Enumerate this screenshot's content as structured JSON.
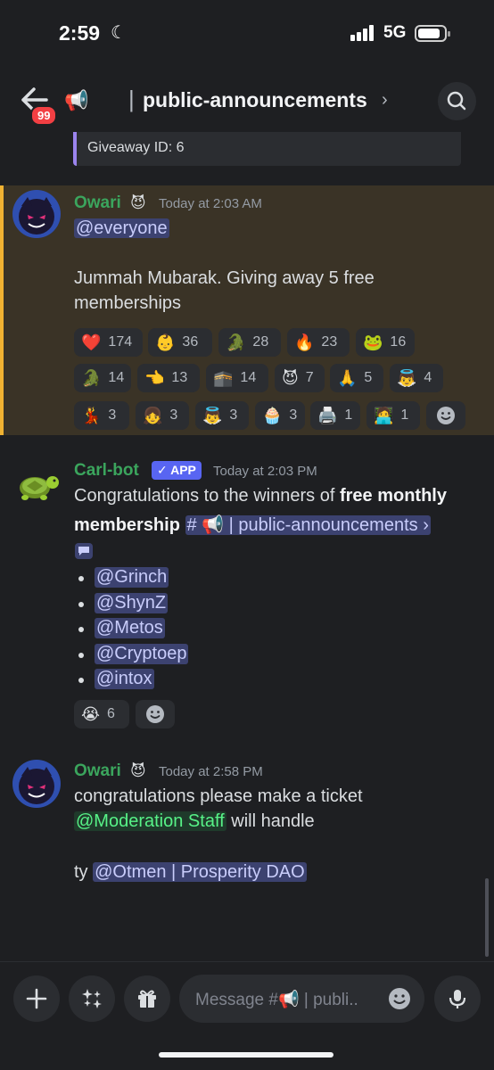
{
  "status": {
    "time": "2:59",
    "network": "5G"
  },
  "header": {
    "badge": "99",
    "channel_name": "public-announcements",
    "separator": "|",
    "chevron": "›"
  },
  "prev_embed": {
    "footer": "Giveaway ID: 6"
  },
  "messages": [
    {
      "author": "Owari",
      "timestamp": "Today at 2:03 AM",
      "mention": "@everyone",
      "text_line1": "Jummah Mubarak. Giving away 5 free",
      "text_line2": "memberships",
      "reactions": [
        {
          "emoji": "❤️",
          "count": "174"
        },
        {
          "emoji": "👶",
          "count": "36"
        },
        {
          "emoji": "🐊",
          "count": "28"
        },
        {
          "emoji": "🔥",
          "count": "23"
        },
        {
          "emoji": "🐸",
          "count": "16"
        },
        {
          "emoji": "🐊",
          "count": "14"
        },
        {
          "emoji": "👈",
          "count": "13"
        },
        {
          "emoji": "🕋",
          "count": "14"
        },
        {
          "emoji": "😈",
          "count": "7"
        },
        {
          "emoji": "🙏",
          "count": "5"
        },
        {
          "emoji": "👼",
          "count": "4"
        },
        {
          "emoji": "💃",
          "count": "3"
        },
        {
          "emoji": "👧",
          "count": "3"
        },
        {
          "emoji": "👼",
          "count": "3"
        },
        {
          "emoji": "🧁",
          "count": "3"
        },
        {
          "emoji": "🖨️",
          "count": "1"
        },
        {
          "emoji": "🧑‍💻",
          "count": "1"
        }
      ]
    },
    {
      "author": "Carl-bot",
      "app_tag": "✓ APP",
      "timestamp": "Today at 2:03 PM",
      "text_line1": "Congratulations to the winners of",
      "text_bold1": "free monthly",
      "text_bold2": "membership",
      "channel_link": "# 📢 | public-announcements ›",
      "winners": [
        "@Grinch",
        "@ShynZ",
        "@Metos",
        "@Cryptoep",
        "@intox"
      ],
      "reaction": {
        "emoji": "😭",
        "count": "6"
      }
    },
    {
      "author": "Owari",
      "timestamp": "Today at 2:58 PM",
      "text_line1": "congratulations please make a ticket",
      "role_mention": "@Moderation Staff",
      "text_after_role": " will handle",
      "ty": "ty ",
      "user_mention": "@Otmen | Prosperity DAO"
    }
  ],
  "input": {
    "placeholder": "Message #📢 | publi.."
  },
  "colors": {
    "background": "#1e1f22",
    "owari_name": "#3ba55d",
    "carlbot_name": "#3ba55d",
    "mention_bg": "#3c4270",
    "highlight_border": "#f0b232",
    "app_tag": "#5865f2"
  }
}
